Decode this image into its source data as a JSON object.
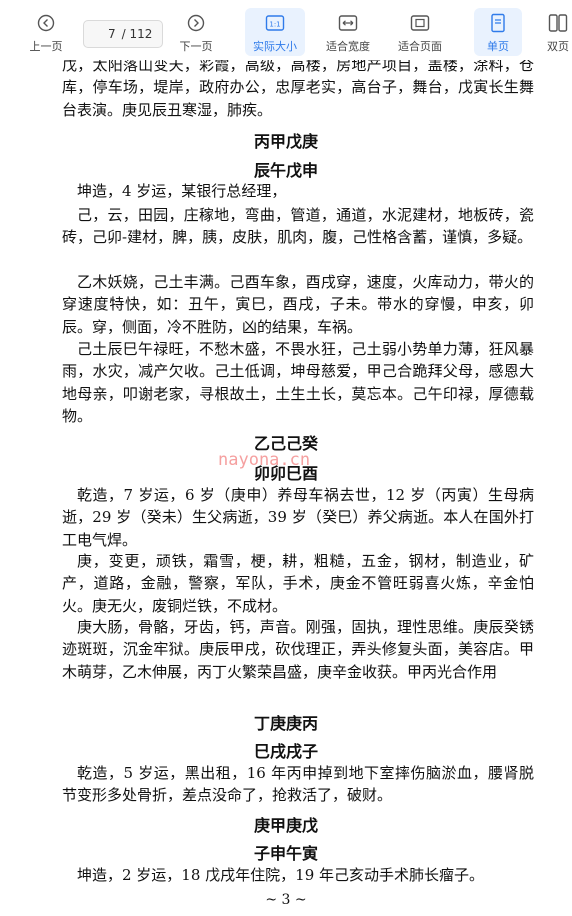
{
  "toolbar": {
    "prev_label": "上一页",
    "current_page": "7",
    "total_pages": "/ 112",
    "next_label": "下一页",
    "actual_size_label": "实际大小",
    "fit_width_label": "适合宽度",
    "fit_page_label": "适合页面",
    "single_page_label": "单页",
    "double_page_label": "双页"
  },
  "content": {
    "para1": "戊，太阳落山变天，彩霞，高级，高楼，房地产项目，盖楼，涂料，仓库，停车场，堤岸，政府办公，忠厚老实，高台子，舞台，戊寅长生舞台表演。庚见辰丑寒湿，肺疾。",
    "h1": "丙甲戊庚",
    "h2": "辰午戊申",
    "para2": "坤造，4 岁运，某银行总经理，",
    "para3": "己，云，田园，庄稼地，弯曲，管道，通道，水泥建材，地板砖，瓷砖，己卯-建材，脾，胰，皮肤，肌肉，腹，己性格含蓄，谨慎，多疑。",
    "para4": "乙木妖娆，己土丰满。己酉车象，酉戌穿，速度，火库动力，带火的穿速度特快，如：丑午，寅巳，酉戌，子未。带水的穿慢，申亥，卯辰。穿，侧面，冷不胜防，凶的结果，车祸。",
    "para5": "己土辰巳午禄旺，不愁木盛，不畏水狂，己土弱小势单力薄，狂风暴雨，水灾，减产欠收。己土低调，坤母慈爱，甲己合跪拜父母，感恩大地母亲，叩谢老家，寻根故土，土生土长，莫忘本。己午印禄，厚德载物。",
    "h3": "乙己己癸",
    "watermark": "nayona.cn",
    "h4": "卯卯巳酉",
    "para6": "乾造，7 岁运，6 岁（庚申）养母车祸去世，12 岁（丙寅）生母病逝，29 岁（癸未）生父病逝，39 岁（癸巳）养父病逝。本人在国外打工电气焊。",
    "para7": "庚，变更，顽铁，霜雪，梗，耕，粗糙，五金，钢材，制造业，矿产，道路，金融，警察，军队，手术，庚金不管旺弱喜火炼，辛金怕火。庚无火，废铜烂铁，不成材。",
    "para8": "庚大肠，骨骼，牙齿，钙，声音。刚强，固执，理性思维。庚辰癸锈迹斑斑，沉金牢狱。庚辰甲戌，砍伐理正，弄头修复头面，美容店。甲木萌芽，乙木伸展，丙丁火繁荣昌盛，庚辛金收获。甲丙光合作用",
    "h5": "丁庚庚丙",
    "h6": "巳戌戌子",
    "para9": "乾造，5 岁运，黑出租，16 年丙申掉到地下室摔伤脑淤血，腰肾脱节变形多处骨折，差点没命了，抢救活了，破财。",
    "h7": "庚甲庚戊",
    "h8": "子申午寅",
    "para10": "坤造，2 岁运，18 戊戌年住院，19 年己亥动手术肺长瘤子。",
    "page_number": "~ 3 ~"
  }
}
